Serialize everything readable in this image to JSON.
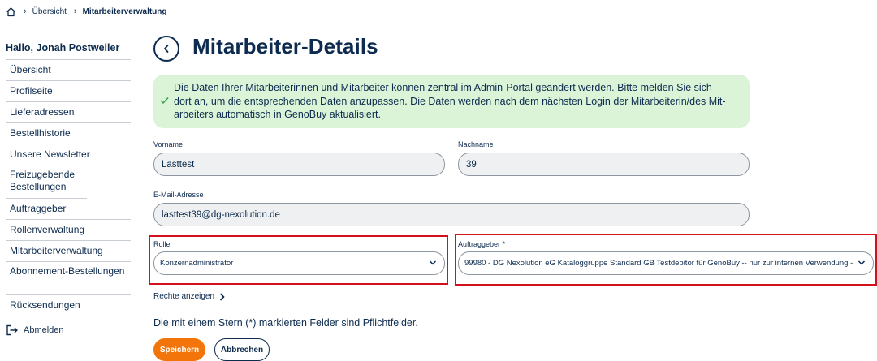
{
  "breadcrumb": {
    "home_icon": "home-icon",
    "items": [
      "Übersicht",
      "Mitarbeiterverwaltung"
    ]
  },
  "sidebar": {
    "greeting": "Hallo, Jonah Postweiler",
    "items": [
      {
        "label": "Übersicht"
      },
      {
        "label": "Profilseite"
      },
      {
        "label": "Lieferadressen"
      },
      {
        "label": "Bestellhistorie"
      },
      {
        "label": "Unsere Newsletter"
      },
      {
        "label": "Freizugebende Bestellungen"
      },
      {
        "label": "Auftraggeber"
      },
      {
        "label": "Rollenverwaltung"
      },
      {
        "label": "Mitarbeiterverwaltung"
      },
      {
        "label": "Abonnement-Bestellungen"
      },
      {
        "label": "Rücksendungen"
      }
    ],
    "logout_label": "Abmelden"
  },
  "main": {
    "title": "Mitarbeiter-Details",
    "info": {
      "text_before_link": "Die Daten Ihrer Mitarbeiterinnen und Mitarbeiter können zentral im ",
      "link": "Admin-Portal",
      "text_after_link_line1": " geändert werden. Bitte melden Sie sich",
      "line2": "dort an, um die entsprechenden Daten anzupassen. Die Daten werden nach dem nächsten Login der Mitarbeiterin/des Mit-",
      "line3": "arbeiters automatisch in GenoBuy aktualisiert."
    },
    "form": {
      "vorname_label": "Vorname",
      "vorname_value": "Lasttest",
      "nachname_label": "Nachname",
      "nachname_value": "39",
      "email_label": "E-Mail-Adresse",
      "email_value": "lasttest39@dg-nexolution.de",
      "rolle_label": "Rolle",
      "rolle_value": "Konzernadministrator",
      "auftraggeber_label": "Auftraggeber *",
      "auftraggeber_value": "99980 - DG Nexolution eG Kataloggruppe Standard GB Testdebitor für GenoBuy -- nur zur internen Verwendung --"
    },
    "rights_link": "Rechte anzeigen",
    "required_note": "Die mit einem Stern (*) markierten Felder sind Pflichtfelder.",
    "save_label": "Speichern",
    "cancel_label": "Abbrechen"
  },
  "colors": {
    "primary": "#0d2b4e",
    "accent": "#f3750a",
    "info_bg": "#dbf4d8",
    "highlight": "#d1121c"
  }
}
